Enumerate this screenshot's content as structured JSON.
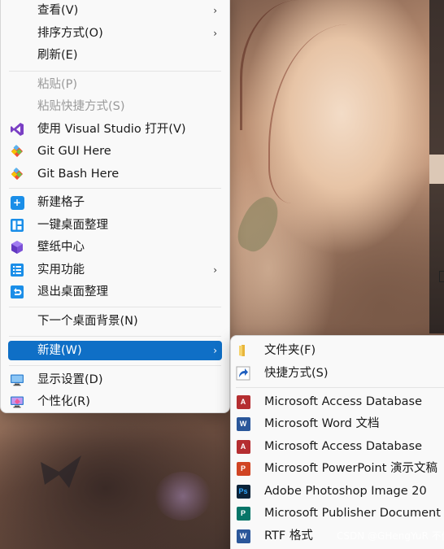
{
  "main_menu": {
    "items": [
      {
        "label": "查看(V)",
        "icon": "",
        "submenu": true,
        "disabled": false
      },
      {
        "label": "排序方式(O)",
        "icon": "",
        "submenu": true,
        "disabled": false
      },
      {
        "label": "刷新(E)",
        "icon": "",
        "submenu": false,
        "disabled": false
      },
      {
        "label": "粘贴(P)",
        "icon": "",
        "submenu": false,
        "disabled": true
      },
      {
        "label": "粘贴快捷方式(S)",
        "icon": "",
        "submenu": false,
        "disabled": true
      },
      {
        "label": "使用 Visual Studio 打开(V)",
        "icon": "visual-studio-icon",
        "submenu": false,
        "disabled": false
      },
      {
        "label": "Git GUI Here",
        "icon": "git-gui-icon",
        "submenu": false,
        "disabled": false
      },
      {
        "label": "Git Bash Here",
        "icon": "git-bash-icon",
        "submenu": false,
        "disabled": false
      },
      {
        "label": "新建格子",
        "icon": "add-grid-icon",
        "submenu": false,
        "disabled": false
      },
      {
        "label": "一键桌面整理",
        "icon": "desktop-organize-icon",
        "submenu": false,
        "disabled": false
      },
      {
        "label": "壁纸中心",
        "icon": "wallpaper-center-icon",
        "submenu": false,
        "disabled": false
      },
      {
        "label": "实用功能",
        "icon": "utilities-icon",
        "submenu": true,
        "disabled": false
      },
      {
        "label": "退出桌面整理",
        "icon": "exit-organize-icon",
        "submenu": false,
        "disabled": false
      },
      {
        "label": "下一个桌面背景(N)",
        "icon": "",
        "submenu": false,
        "disabled": false
      },
      {
        "label": "新建(W)",
        "icon": "",
        "submenu": true,
        "disabled": false,
        "selected": true
      },
      {
        "label": "显示设置(D)",
        "icon": "display-settings-icon",
        "submenu": false,
        "disabled": false
      },
      {
        "label": "个性化(R)",
        "icon": "personalize-icon",
        "submenu": false,
        "disabled": false
      }
    ]
  },
  "new_submenu": {
    "items": [
      {
        "label": "文件夹(F)",
        "icon": "folder-icon"
      },
      {
        "label": "快捷方式(S)",
        "icon": "shortcut-icon"
      },
      {
        "label": "Microsoft Access Database",
        "icon": "access-icon"
      },
      {
        "label": "Microsoft Word 文档",
        "icon": "word-icon"
      },
      {
        "label": "Microsoft Access Database",
        "icon": "access-icon"
      },
      {
        "label": "Microsoft PowerPoint 演示文稿",
        "icon": "powerpoint-icon"
      },
      {
        "label": "Adobe Photoshop Image 20",
        "icon": "photoshop-icon"
      },
      {
        "label": "Microsoft Publisher Document",
        "icon": "publisher-icon"
      },
      {
        "label": "RTF 格式",
        "icon": "rtf-icon"
      }
    ]
  },
  "watermark": "CSDN @GHengYuR 不偶",
  "colors": {
    "selection": "#0f6fc6",
    "menu_background": "#f9f9f9",
    "disabled_text": "#9a9a9a"
  }
}
